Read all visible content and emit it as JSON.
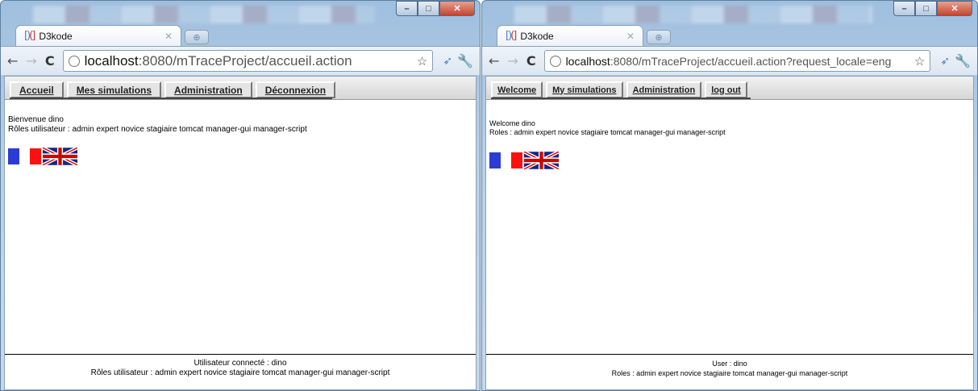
{
  "colors": {
    "flag_blue": "#2b3bd6",
    "flag_white": "#ffffff",
    "flag_red": "#ff1010",
    "uk_blue": "#1a237e",
    "uk_red": "#d00000"
  },
  "left": {
    "tab_title": "D3kode",
    "url_host": "localhost",
    "url_rest": ":8080/mTraceProject/accueil.action",
    "menu": [
      "Accueil",
      "Mes simulations",
      "Administration",
      "Déconnexion"
    ],
    "welcome": "Bienvenue dino",
    "roles": "Rôles utilisateur : admin expert novice stagiaire tomcat manager-gui manager-script",
    "footer_user": "Utilisateur connecté : dino",
    "footer_roles": "Rôles utilisateur : admin expert novice stagiaire tomcat manager-gui manager-script"
  },
  "right": {
    "tab_title": "D3kode",
    "url_host": "localhost",
    "url_rest": ":8080/mTraceProject/accueil.action?request_locale=eng",
    "menu": [
      "Welcome",
      "My simulations",
      "Administration",
      "log out"
    ],
    "welcome": "Welcome dino",
    "roles": "Roles : admin expert novice stagiaire tomcat manager-gui manager-script",
    "footer_user": "User : dino",
    "footer_roles": "Roles : admin expert novice stagiaire tomcat manager-gui manager-script"
  },
  "icons": [
    "favicon-icon",
    "close-icon",
    "new-tab-icon",
    "back-icon",
    "forward-icon",
    "reload-icon",
    "globe-icon",
    "star-icon",
    "extension-icon",
    "wrench-icon",
    "french-flag-icon",
    "uk-flag-icon"
  ]
}
